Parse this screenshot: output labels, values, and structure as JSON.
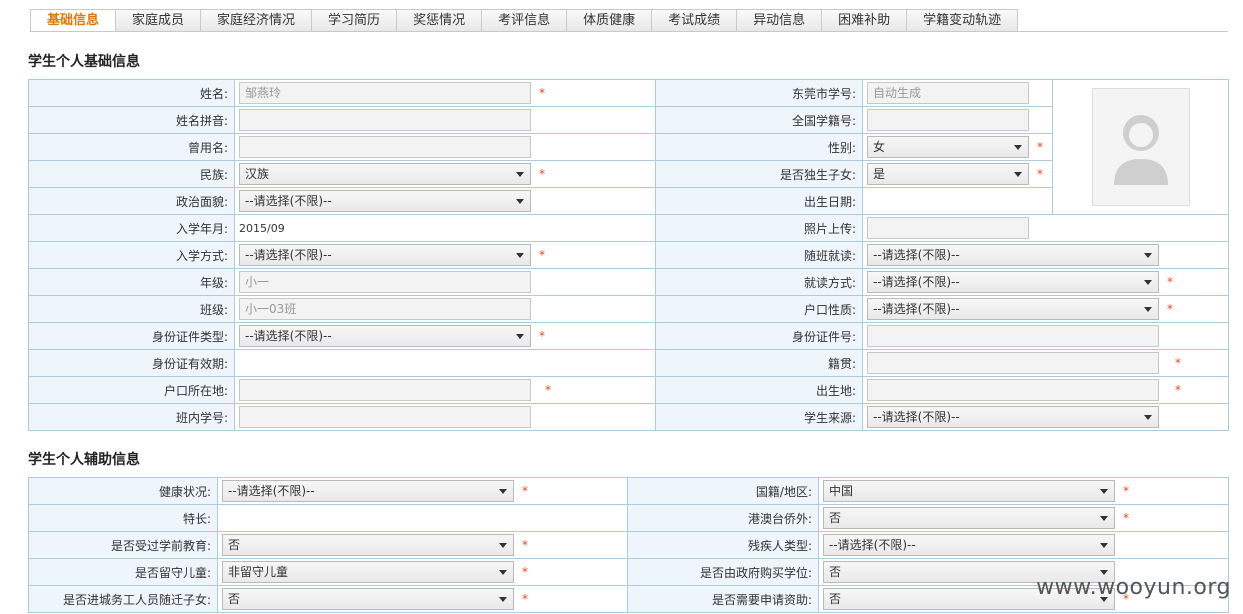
{
  "tabs": [
    "基础信息",
    "家庭成员",
    "家庭经济情况",
    "学习简历",
    "奖惩情况",
    "考评信息",
    "体质健康",
    "考试成绩",
    "异动信息",
    "困难补助",
    "学籍变动轨迹"
  ],
  "section1_title": "学生个人基础信息",
  "section2_title": "学生个人辅助信息",
  "required_mark": "*",
  "basic": {
    "name_label": "姓名:",
    "name_value": "邹燕玲",
    "dg_id_label": "东莞市学号:",
    "dg_id_value": "自动生成",
    "pinyin_label": "姓名拼音:",
    "national_id_label": "全国学籍号:",
    "former_name_label": "曾用名:",
    "gender_label": "性别:",
    "gender_value": "女",
    "ethnic_label": "民族:",
    "ethnic_value": "汉族",
    "only_child_label": "是否独生子女:",
    "only_child_value": "是",
    "political_label": "政治面貌:",
    "political_value": "--请选择(不限)--",
    "birthdate_label": "出生日期:",
    "enroll_label": "入学年月:",
    "enroll_value": "2015/09",
    "photo_label": "照片上传:",
    "enroll_mode_label": "入学方式:",
    "enroll_mode_value": "--请选择(不限)--",
    "follow_class_label": "随班就读:",
    "follow_class_value": "--请选择(不限)--",
    "grade_label": "年级:",
    "grade_value": "小一",
    "study_mode_label": "就读方式:",
    "study_mode_value": "--请选择(不限)--",
    "class_label": "班级:",
    "class_value": "小一03班",
    "hukou_type_label": "户口性质:",
    "hukou_type_value": "--请选择(不限)--",
    "id_type_label": "身份证件类型:",
    "id_type_value": "--请选择(不限)--",
    "id_no_label": "身份证件号:",
    "id_valid_label": "身份证有效期:",
    "native_label": "籍贯:",
    "hukou_loc_label": "户口所在地:",
    "birthplace_label": "出生地:",
    "class_no_label": "班内学号:",
    "source_label": "学生来源:",
    "source_value": "--请选择(不限)--"
  },
  "aux": {
    "health_label": "健康状况:",
    "health_value": "--请选择(不限)--",
    "nationality_label": "国籍/地区:",
    "nationality_value": "中国",
    "talent_label": "特长:",
    "overseas_label": "港澳台侨外:",
    "overseas_value": "否",
    "preschool_label": "是否受过学前教育:",
    "preschool_value": "否",
    "disability_label": "残疾人类型:",
    "disability_value": "--请选择(不限)--",
    "left_behind_label": "是否留守儿童:",
    "left_behind_value": "非留守儿童",
    "gov_purchase_label": "是否由政府购买学位:",
    "gov_purchase_value": "否",
    "migrant_label": "是否进城务工人员随迁子女:",
    "migrant_value": "否",
    "aid_label": "是否需要申请资助:",
    "aid_value": "否"
  },
  "watermark": "www.wooyun.org"
}
